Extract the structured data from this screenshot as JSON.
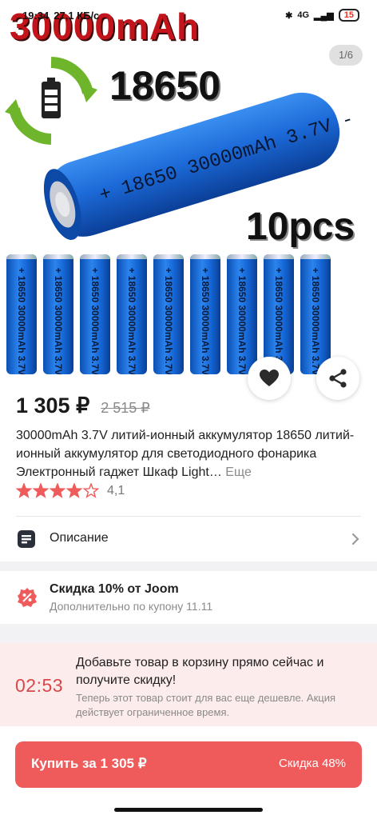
{
  "status_bar": {
    "time": "19:34",
    "speed": "27,1 КБ/с",
    "network": "4G",
    "battery": "15"
  },
  "gallery": {
    "counter": "1/6",
    "banner_capacity": "30000mAh",
    "banner_model": "18650",
    "banner_quantity": "10pcs",
    "big_cell_label": "+ 18650 30000mAh 3.7V -",
    "cell_label": "+ 18650 30000mAh 3.7V",
    "cell_count": 9
  },
  "product": {
    "price": "1 305 ₽",
    "old_price": "2 515 ₽",
    "title": "30000mAh 3.7V литий-ионный аккумулятор 18650 литий-ионный аккумулятор для светодиодного фонарика Электронный гаджет Шкаф Light…",
    "more_label": "Еще",
    "rating": "4,1",
    "rating_stars": 4.1
  },
  "description": {
    "label": "Описание"
  },
  "discount": {
    "title": "Скидка 10% от Joom",
    "subtitle": "Дополнительно по купону 11.11"
  },
  "timer": {
    "value": "02:53",
    "title": "Добавьте товар в корзину прямо сейчас и получите скидку!",
    "subtitle": "Теперь этот товар стоит для вас еще дешевле. Акция действует ограниченное время."
  },
  "buy": {
    "label": "Купить за 1 305 ₽",
    "discount": "Скидка 48%"
  },
  "colors": {
    "accent": "#ef5b5b",
    "timer_bg": "#fdecec",
    "star": "#ef5b5b"
  }
}
